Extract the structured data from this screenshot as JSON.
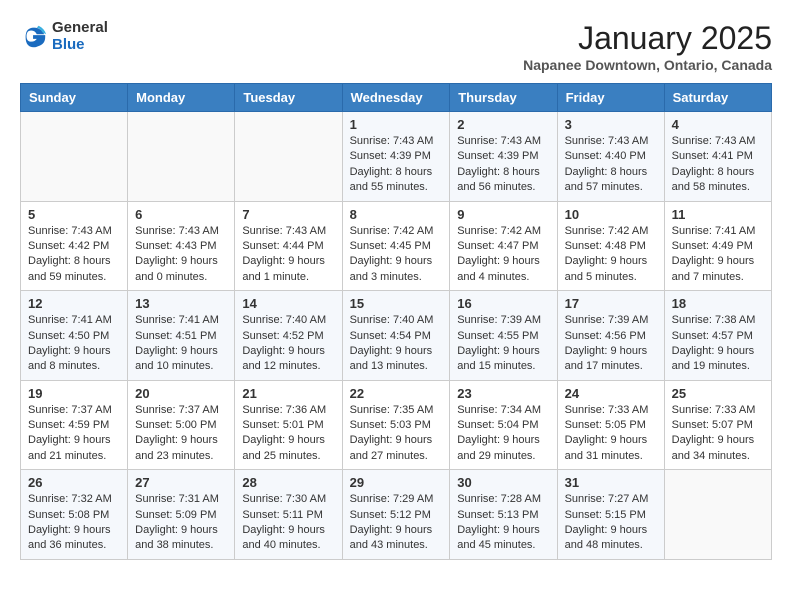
{
  "logo": {
    "general": "General",
    "blue": "Blue"
  },
  "title": "January 2025",
  "location": "Napanee Downtown, Ontario, Canada",
  "weekdays": [
    "Sunday",
    "Monday",
    "Tuesday",
    "Wednesday",
    "Thursday",
    "Friday",
    "Saturday"
  ],
  "weeks": [
    [
      {
        "day": "",
        "content": ""
      },
      {
        "day": "",
        "content": ""
      },
      {
        "day": "",
        "content": ""
      },
      {
        "day": "1",
        "content": "Sunrise: 7:43 AM\nSunset: 4:39 PM\nDaylight: 8 hours and 55 minutes."
      },
      {
        "day": "2",
        "content": "Sunrise: 7:43 AM\nSunset: 4:39 PM\nDaylight: 8 hours and 56 minutes."
      },
      {
        "day": "3",
        "content": "Sunrise: 7:43 AM\nSunset: 4:40 PM\nDaylight: 8 hours and 57 minutes."
      },
      {
        "day": "4",
        "content": "Sunrise: 7:43 AM\nSunset: 4:41 PM\nDaylight: 8 hours and 58 minutes."
      }
    ],
    [
      {
        "day": "5",
        "content": "Sunrise: 7:43 AM\nSunset: 4:42 PM\nDaylight: 8 hours and 59 minutes."
      },
      {
        "day": "6",
        "content": "Sunrise: 7:43 AM\nSunset: 4:43 PM\nDaylight: 9 hours and 0 minutes."
      },
      {
        "day": "7",
        "content": "Sunrise: 7:43 AM\nSunset: 4:44 PM\nDaylight: 9 hours and 1 minute."
      },
      {
        "day": "8",
        "content": "Sunrise: 7:42 AM\nSunset: 4:45 PM\nDaylight: 9 hours and 3 minutes."
      },
      {
        "day": "9",
        "content": "Sunrise: 7:42 AM\nSunset: 4:47 PM\nDaylight: 9 hours and 4 minutes."
      },
      {
        "day": "10",
        "content": "Sunrise: 7:42 AM\nSunset: 4:48 PM\nDaylight: 9 hours and 5 minutes."
      },
      {
        "day": "11",
        "content": "Sunrise: 7:41 AM\nSunset: 4:49 PM\nDaylight: 9 hours and 7 minutes."
      }
    ],
    [
      {
        "day": "12",
        "content": "Sunrise: 7:41 AM\nSunset: 4:50 PM\nDaylight: 9 hours and 8 minutes."
      },
      {
        "day": "13",
        "content": "Sunrise: 7:41 AM\nSunset: 4:51 PM\nDaylight: 9 hours and 10 minutes."
      },
      {
        "day": "14",
        "content": "Sunrise: 7:40 AM\nSunset: 4:52 PM\nDaylight: 9 hours and 12 minutes."
      },
      {
        "day": "15",
        "content": "Sunrise: 7:40 AM\nSunset: 4:54 PM\nDaylight: 9 hours and 13 minutes."
      },
      {
        "day": "16",
        "content": "Sunrise: 7:39 AM\nSunset: 4:55 PM\nDaylight: 9 hours and 15 minutes."
      },
      {
        "day": "17",
        "content": "Sunrise: 7:39 AM\nSunset: 4:56 PM\nDaylight: 9 hours and 17 minutes."
      },
      {
        "day": "18",
        "content": "Sunrise: 7:38 AM\nSunset: 4:57 PM\nDaylight: 9 hours and 19 minutes."
      }
    ],
    [
      {
        "day": "19",
        "content": "Sunrise: 7:37 AM\nSunset: 4:59 PM\nDaylight: 9 hours and 21 minutes."
      },
      {
        "day": "20",
        "content": "Sunrise: 7:37 AM\nSunset: 5:00 PM\nDaylight: 9 hours and 23 minutes."
      },
      {
        "day": "21",
        "content": "Sunrise: 7:36 AM\nSunset: 5:01 PM\nDaylight: 9 hours and 25 minutes."
      },
      {
        "day": "22",
        "content": "Sunrise: 7:35 AM\nSunset: 5:03 PM\nDaylight: 9 hours and 27 minutes."
      },
      {
        "day": "23",
        "content": "Sunrise: 7:34 AM\nSunset: 5:04 PM\nDaylight: 9 hours and 29 minutes."
      },
      {
        "day": "24",
        "content": "Sunrise: 7:33 AM\nSunset: 5:05 PM\nDaylight: 9 hours and 31 minutes."
      },
      {
        "day": "25",
        "content": "Sunrise: 7:33 AM\nSunset: 5:07 PM\nDaylight: 9 hours and 34 minutes."
      }
    ],
    [
      {
        "day": "26",
        "content": "Sunrise: 7:32 AM\nSunset: 5:08 PM\nDaylight: 9 hours and 36 minutes."
      },
      {
        "day": "27",
        "content": "Sunrise: 7:31 AM\nSunset: 5:09 PM\nDaylight: 9 hours and 38 minutes."
      },
      {
        "day": "28",
        "content": "Sunrise: 7:30 AM\nSunset: 5:11 PM\nDaylight: 9 hours and 40 minutes."
      },
      {
        "day": "29",
        "content": "Sunrise: 7:29 AM\nSunset: 5:12 PM\nDaylight: 9 hours and 43 minutes."
      },
      {
        "day": "30",
        "content": "Sunrise: 7:28 AM\nSunset: 5:13 PM\nDaylight: 9 hours and 45 minutes."
      },
      {
        "day": "31",
        "content": "Sunrise: 7:27 AM\nSunset: 5:15 PM\nDaylight: 9 hours and 48 minutes."
      },
      {
        "day": "",
        "content": ""
      }
    ]
  ]
}
